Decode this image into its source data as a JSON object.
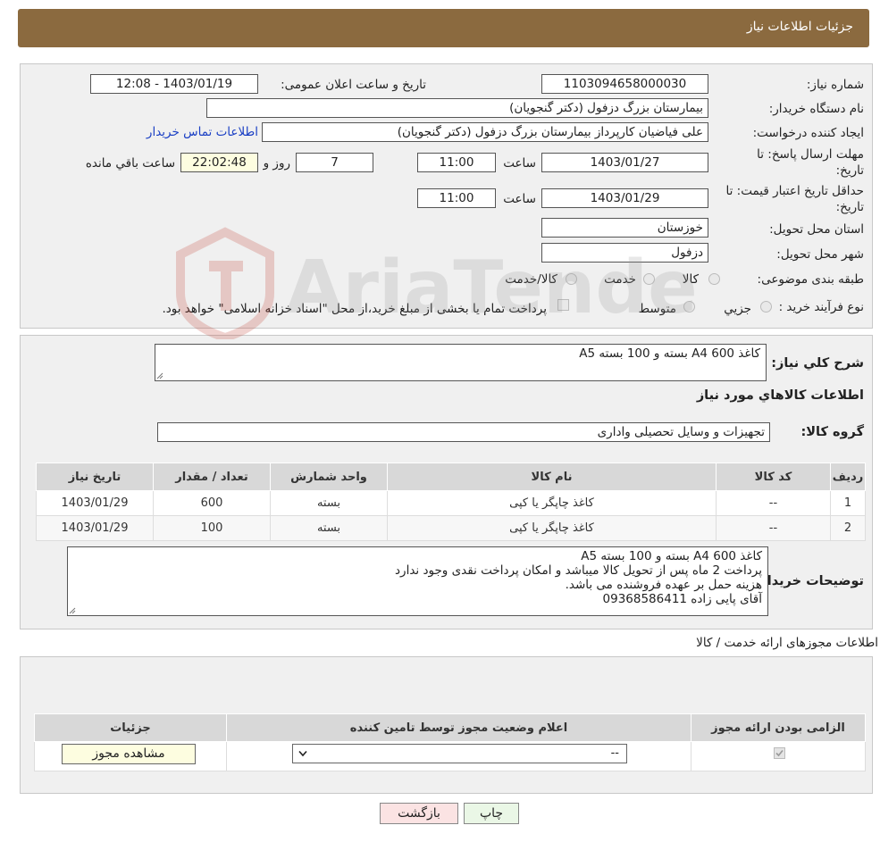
{
  "header": {
    "title": "جزئیات اطلاعات نیاز"
  },
  "info": {
    "need_number_label": "شماره نیاز:",
    "need_number": "1103094658000030",
    "announce_label": "تاریخ و ساعت اعلان عمومی:",
    "announce_value": "1403/01/19 - 12:08",
    "buyer_org_label": "نام دستگاه خریدار:",
    "buyer_org": "بیمارستان بزرگ دزفول (دکتر گنجویان)",
    "creator_label": "ایجاد کننده درخواست:",
    "creator": "علی فیاضیان کارپرداز بیمارستان بزرگ دزفول (دکتر گنجویان)",
    "contact_link": "اطلاعات تماس خریدار",
    "deadline_label_1": "مهلت ارسال پاسخ: تا",
    "deadline_label_2": "تاریخ:",
    "deadline_date": "1403/01/27",
    "time_label": "ساعت",
    "deadline_time": "11:00",
    "days_value": "7",
    "days_label": "روز و",
    "remaining_time": "22:02:48",
    "remaining_label": "ساعت باقي مانده",
    "validity_label_1": "حداقل تاریخ اعتبار قیمت: تا",
    "validity_label_2": "تاریخ:",
    "validity_date": "1403/01/29",
    "validity_time_label": "ساعت",
    "validity_time": "11:00",
    "province_label": "استان محل تحویل:",
    "province": "خوزستان",
    "city_label": "شهر محل تحویل:",
    "city": "دزفول",
    "category_label": "طبقه بندی موضوعی:",
    "category_options": [
      "کالا",
      "خدمت",
      "کالا/خدمت"
    ],
    "process_label": "نوع فرآیند خرید :",
    "process_options": [
      "جزیي",
      "متوسط"
    ],
    "payment_note": "پرداخت تمام یا بخشی از مبلغ خرید،از محل \"اسناد خزانه اسلامی\" خواهد بود."
  },
  "description": {
    "label": "شرح كلي نياز:",
    "value": "کاغذ A4 600 بسته و 100 بسته A5",
    "items_title": "اطلاعات کالاهاي مورد نياز",
    "group_label": "گروه کالا:",
    "group_value": "تجهیزات و وسایل تحصیلی واداری"
  },
  "goods_table": {
    "headers": [
      "رديف",
      "کد کالا",
      "نام کالا",
      "واحد شمارش",
      "تعداد / مقدار",
      "تاریخ نیاز"
    ],
    "rows": [
      [
        "1",
        "--",
        "کاغذ چاپگر یا کپی",
        "بسته",
        "600",
        "1403/01/29"
      ],
      [
        "2",
        "--",
        "کاغذ چاپگر یا کپی",
        "بسته",
        "100",
        "1403/01/29"
      ]
    ]
  },
  "buyer_notes": {
    "label": "توضیحات خریدار:",
    "lines": [
      "کاغذ A4 600 بسته و 100 بسته A5",
      "پرداخت 2 ماه پس از تحویل کالا میباشد و امکان پرداخت نقدی وجود ندارد",
      "هزینه حمل بر عهده فروشنده می باشد.",
      "آقای پایی زاده 09368586411"
    ]
  },
  "permits": {
    "section_title": "اطلاعات مجوزهای ارائه خدمت / کالا",
    "headers": [
      "الزامی بودن ارائه مجوز",
      "اعلام وضعیت مجوز توسط تامین کننده",
      "جزئیات"
    ],
    "select_value": "--",
    "view_button": "مشاهده مجوز"
  },
  "footer": {
    "print_button": "چاپ",
    "back_button": "بازگشت"
  },
  "watermark": {
    "text": "AriaTender.neT"
  },
  "colors": {
    "header": "#8b6a3f",
    "link": "#1a3fc4",
    "panel": "#f0f0f0"
  }
}
